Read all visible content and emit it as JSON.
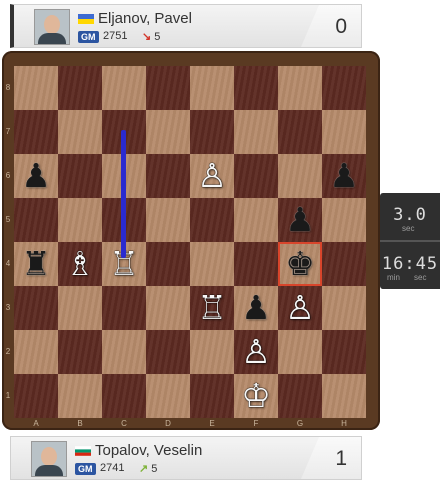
{
  "top_player": {
    "name": "Eljanov, Pavel",
    "title": "GM",
    "rating": "2751",
    "rating_change": "5",
    "rating_direction": "down",
    "score": "0",
    "flag_colors": [
      "#3d6bd2",
      "#ffd700"
    ]
  },
  "bottom_player": {
    "name": "Topalov, Veselin",
    "title": "GM",
    "rating": "2741",
    "rating_change": "5",
    "rating_direction": "up",
    "score": "1",
    "flag_colors": [
      "#ffffff",
      "#00966e",
      "#d62612"
    ]
  },
  "board": {
    "files": [
      "A",
      "B",
      "C",
      "D",
      "E",
      "F",
      "G",
      "H"
    ],
    "ranks": [
      "8",
      "7",
      "6",
      "5",
      "4",
      "3",
      "2",
      "1"
    ],
    "light_color": "#b58a6a",
    "dark_color": "#5d2b22",
    "pieces": [
      {
        "square": "a6",
        "piece": "pawn",
        "color": "b",
        "glyph": "♟"
      },
      {
        "square": "e6",
        "piece": "pawn",
        "color": "w",
        "glyph": "♙"
      },
      {
        "square": "h6",
        "piece": "pawn",
        "color": "b",
        "glyph": "♟"
      },
      {
        "square": "g5",
        "piece": "pawn",
        "color": "b",
        "glyph": "♟"
      },
      {
        "square": "a4",
        "piece": "rook",
        "color": "b",
        "glyph": "♜"
      },
      {
        "square": "b4",
        "piece": "bishop",
        "color": "w",
        "glyph": "♗"
      },
      {
        "square": "c4",
        "piece": "rook",
        "color": "w",
        "glyph": "♖"
      },
      {
        "square": "g4",
        "piece": "king",
        "color": "b",
        "glyph": "♚",
        "in_check": true
      },
      {
        "square": "e3",
        "piece": "rook",
        "color": "w",
        "glyph": "♖"
      },
      {
        "square": "f3",
        "piece": "pawn",
        "color": "b",
        "glyph": "♟"
      },
      {
        "square": "g3",
        "piece": "pawn",
        "color": "w",
        "glyph": "♙"
      },
      {
        "square": "f2",
        "piece": "pawn",
        "color": "w",
        "glyph": "♙"
      },
      {
        "square": "f1",
        "piece": "king",
        "color": "w",
        "glyph": "♔"
      }
    ],
    "last_move": {
      "from": "c7",
      "to": "c4",
      "color": "#2a2ad0"
    }
  },
  "clock": {
    "move_time": "3.0",
    "move_time_unit": "sec",
    "total_min": "16",
    "total_sec": "45",
    "min_label": "min",
    "sec_label": "sec"
  }
}
